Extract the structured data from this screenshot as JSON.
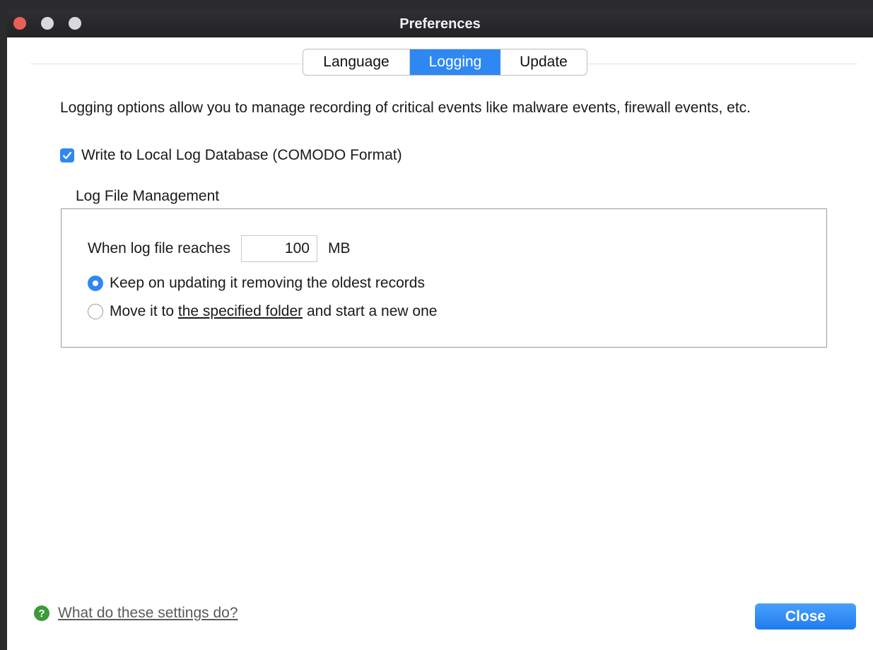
{
  "window": {
    "title": "Preferences"
  },
  "tabs": [
    {
      "label": "Language",
      "selected": false
    },
    {
      "label": "Logging",
      "selected": true
    },
    {
      "label": "Update",
      "selected": false
    }
  ],
  "logging": {
    "description": "Logging options allow you to manage recording of critical events like malware events, firewall events, etc.",
    "write_local": {
      "label": "Write to Local Log Database (COMODO Format)",
      "checked": true
    },
    "group_title": "Log File Management",
    "size_label": "When log file reaches",
    "size_value": "100",
    "size_unit": "MB",
    "option_keep": {
      "label": "Keep on updating it removing the oldest records",
      "selected": true
    },
    "option_move": {
      "prefix": "Move it to ",
      "link": "the specified folder",
      "suffix": " and start a new one",
      "selected": false
    }
  },
  "footer": {
    "help_icon": "help-icon",
    "help_link": "What do these settings do?",
    "close_label": "Close"
  },
  "colors": {
    "accent": "#2f88f2",
    "help_green": "#3c9a3a",
    "close_red": "#ec5f57"
  }
}
